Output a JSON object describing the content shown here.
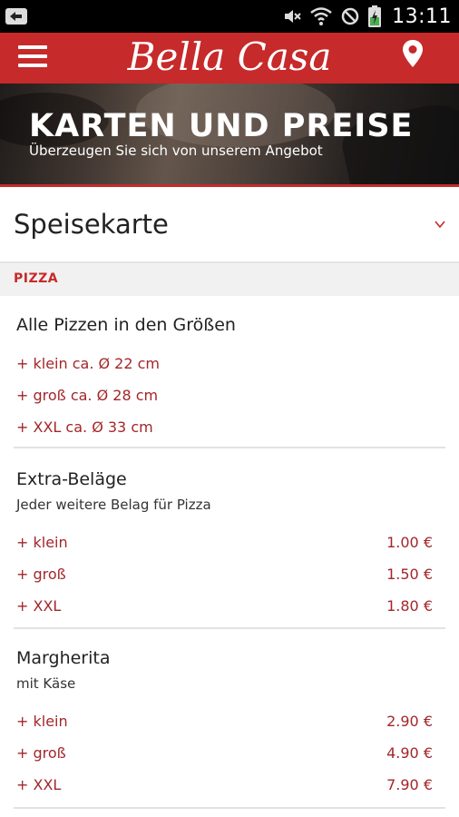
{
  "status_bar": {
    "time": "13:11"
  },
  "app_bar": {
    "brand": "Bella Casa",
    "menu_icon": "hamburger-menu-icon",
    "location_icon": "map-pin-icon",
    "color": "#c62a2a"
  },
  "hero": {
    "title": "KARTEN UND PREISE",
    "subtitle": "Überzeugen Sie sich von unserem Angebot"
  },
  "selector": {
    "value": "Speisekarte",
    "icon": "chevron-down-icon"
  },
  "section": {
    "label": "PIZZA"
  },
  "items": [
    {
      "name": "Alle Pizzen in den Größen",
      "description": "",
      "options": [
        {
          "label": "+ klein ca. Ø 22 cm",
          "price": ""
        },
        {
          "label": "+ groß ca. Ø 28 cm",
          "price": ""
        },
        {
          "label": "+ XXL ca. Ø 33 cm",
          "price": ""
        }
      ]
    },
    {
      "name": "Extra-Beläge",
      "description": "Jeder weitere Belag für Pizza",
      "options": [
        {
          "label": "+ klein",
          "price": "1.00 €"
        },
        {
          "label": "+ groß",
          "price": "1.50 €"
        },
        {
          "label": "+ XXL",
          "price": "1.80 €"
        }
      ]
    },
    {
      "name": "Margherita",
      "description": "mit Käse",
      "options": [
        {
          "label": "+ klein",
          "price": "2.90 €"
        },
        {
          "label": "+ groß",
          "price": "4.90 €"
        },
        {
          "label": "+ XXL",
          "price": "7.90 €"
        }
      ]
    }
  ]
}
